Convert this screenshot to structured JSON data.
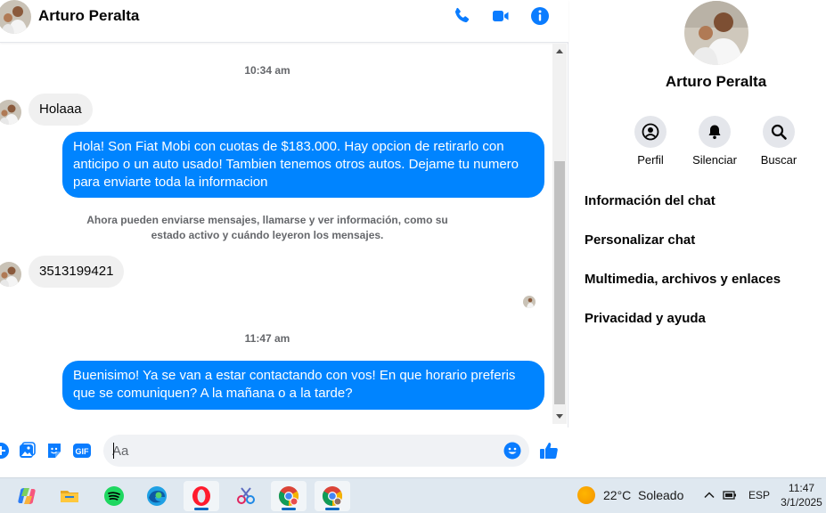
{
  "header": {
    "contact_name": "Arturo Peralta",
    "icons": [
      "phone-icon",
      "video-camera-icon",
      "info-icon"
    ]
  },
  "messages": {
    "timestamp_1": "10:34 am",
    "incoming_1": "Holaaa",
    "outgoing_1": "Hola! Son Fiat Mobi con cuotas de $183.000. Hay opcion de retirarlo con anticipo o un auto usado! Tambien tenemos otros autos. Dejame tu numero para enviarte toda la informacion",
    "system_note": "Ahora pueden enviarse mensajes, llamarse y ver información, como su estado activo y cuándo leyeron los mensajes.",
    "incoming_2": "3513199421",
    "timestamp_2": "11:47 am",
    "outgoing_2": "Buenisimo! Ya se van a estar contactando con vos! En que horario preferis que se comuniquen? A la mañana o a la tarde?"
  },
  "composer": {
    "placeholder": "Aa",
    "icons": [
      "plus-icon",
      "image-icon",
      "sticker-icon",
      "gif-icon",
      "emoji-icon",
      "like-icon"
    ],
    "gif_label": "GIF"
  },
  "info_panel": {
    "name": "Arturo Peralta",
    "actions": [
      {
        "label": "Perfil",
        "icon": "profile-icon"
      },
      {
        "label": "Silenciar",
        "icon": "bell-icon"
      },
      {
        "label": "Buscar",
        "icon": "search-icon"
      }
    ],
    "items": [
      "Información del chat",
      "Personalizar chat",
      "Multimedia, archivos y enlaces",
      "Privacidad y ayuda"
    ]
  },
  "taskbar": {
    "apps": [
      "copilot-icon",
      "file-explorer-icon",
      "spotify-icon",
      "edge-icon",
      "opera-icon",
      "snipping-tool-icon",
      "chrome-icon",
      "chrome-profile-icon"
    ],
    "weather_temp": "22°C",
    "weather_desc": "Soleado",
    "language": "ESP",
    "time": "11:47",
    "date": "3/1/2025"
  },
  "colors": {
    "accent": "#0084ff",
    "icon_blue": "#0a7cff",
    "incoming_bubble": "#f0f0f0",
    "secondary_text": "#65676b",
    "taskbar": "#dfe8f0"
  }
}
